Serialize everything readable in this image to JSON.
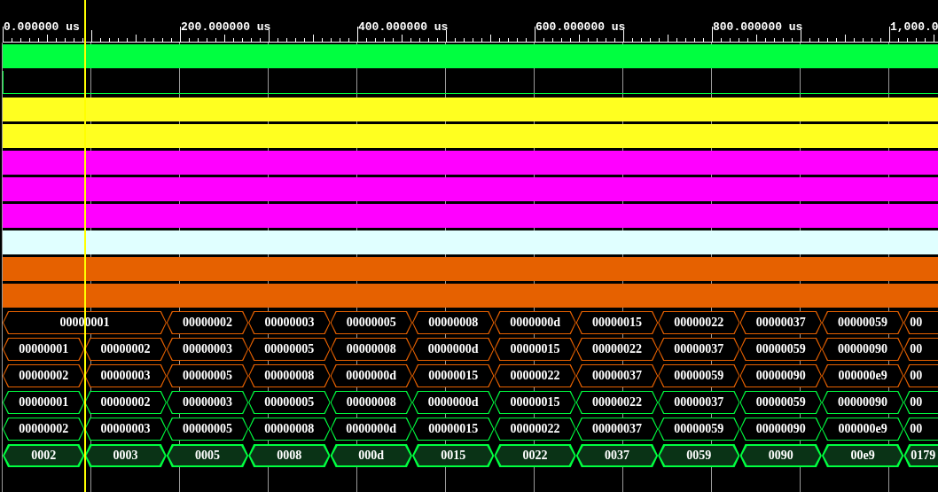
{
  "timeline": {
    "labels": [
      "0.000000 us",
      "200.000000 us",
      "400.000000 us",
      "600.000000 us",
      "800.000000 us",
      "1,000.0"
    ]
  },
  "cursor": {
    "level": 0.087
  },
  "waves": [
    {
      "kind": "bit",
      "high": true,
      "color": "#00ff40",
      "selected": false
    },
    {
      "kind": "bit",
      "high": false,
      "color": "#00ff40",
      "selected": false
    },
    {
      "kind": "bit",
      "high": true,
      "color": "#ffff20",
      "selected": false
    },
    {
      "kind": "bit",
      "high": true,
      "color": "#ffff20",
      "selected": false
    },
    {
      "kind": "bit",
      "high": true,
      "color": "#ff00ff",
      "selected": false
    },
    {
      "kind": "bit",
      "high": true,
      "color": "#ff00ff",
      "selected": false
    },
    {
      "kind": "bit",
      "high": true,
      "color": "#ff00ff",
      "selected": false
    },
    {
      "kind": "bit",
      "high": true,
      "color": "#e0ffff",
      "selected": false
    },
    {
      "kind": "bit",
      "high": true,
      "color": "#e66100",
      "selected": false
    },
    {
      "kind": "bit",
      "high": true,
      "color": "#e66100",
      "selected": false
    },
    {
      "kind": "bus",
      "color": "#e66100",
      "selected": false,
      "values": [
        "00000001",
        "00000002",
        "00000003",
        "00000005",
        "00000008",
        "0000000d",
        "00000015",
        "00000022",
        "00000037",
        "00000059",
        "00"
      ]
    },
    {
      "kind": "bus",
      "color": "#e66100",
      "selected": false,
      "values": [
        "00000001",
        "00000002",
        "00000003",
        "00000005",
        "00000008",
        "0000000d",
        "00000015",
        "00000022",
        "00000037",
        "00000059",
        "00000090",
        "00"
      ]
    },
    {
      "kind": "bus",
      "color": "#e66100",
      "selected": false,
      "values": [
        "00000002",
        "00000003",
        "00000005",
        "00000008",
        "0000000d",
        "00000015",
        "00000022",
        "00000037",
        "00000059",
        "00000090",
        "000000e9",
        "00"
      ]
    },
    {
      "kind": "bus",
      "color": "#00ff40",
      "selected": false,
      "values": [
        "00000001",
        "00000002",
        "00000003",
        "00000005",
        "00000008",
        "0000000d",
        "00000015",
        "00000022",
        "00000037",
        "00000059",
        "00000090",
        "00"
      ]
    },
    {
      "kind": "bus",
      "color": "#00ff40",
      "selected": false,
      "values": [
        "00000002",
        "00000003",
        "00000005",
        "00000008",
        "0000000d",
        "00000015",
        "00000022",
        "00000037",
        "00000059",
        "00000090",
        "000000e9",
        "00"
      ]
    },
    {
      "kind": "bus",
      "color": "#00ff40",
      "selected": true,
      "values": [
        "0002",
        "0003",
        "0005",
        "0008",
        "000d",
        "0015",
        "0022",
        "0037",
        "0059",
        "0090",
        "00e9",
        "0179"
      ]
    }
  ]
}
